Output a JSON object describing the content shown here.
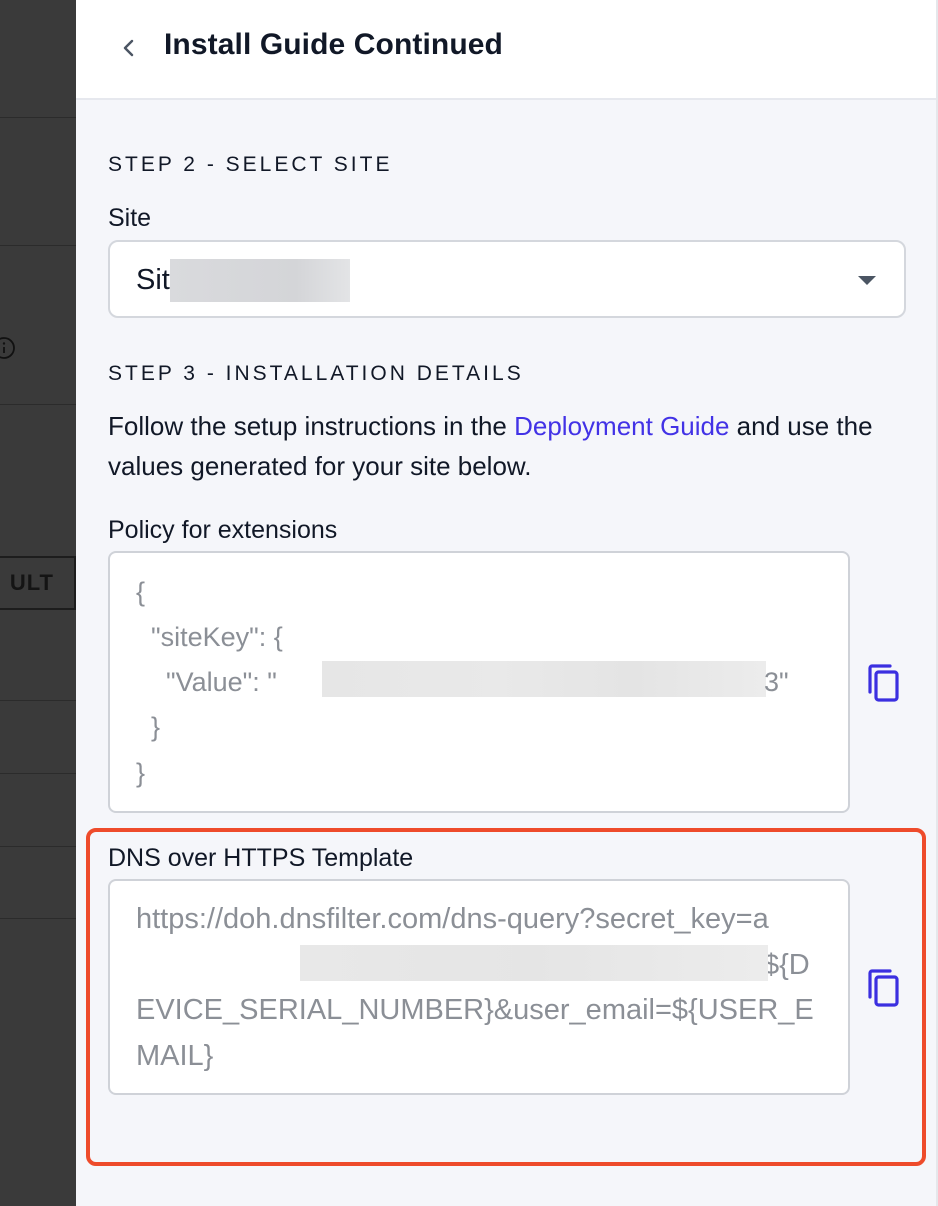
{
  "panel": {
    "title": "Install Guide Continued"
  },
  "background": {
    "chip_label": "ULT"
  },
  "step2": {
    "heading": "STEP 2 - SELECT SITE",
    "site_label": "Site",
    "site_value_visible": "Sit"
  },
  "step3": {
    "heading": "STEP 3 - INSTALLATION DETAILS",
    "instructions_before": "Follow the setup instructions in the ",
    "instructions_link": "Deployment Guide",
    "instructions_after": " and use the values generated for your site below.",
    "policy_label": "Policy for extensions",
    "policy_lines": [
      "{",
      "  \"siteKey\": {",
      "    \"Value\": \"",
      "3\"",
      "  }",
      "}"
    ],
    "doh_label": "DNS over HTTPS Template",
    "doh_part1": "https://doh.dnsfilter.com/dns-query?secret_key=a",
    "doh_part2": "3&device_sn=${DEVICE_SERIAL_NUMBER}&user_email=${USER_EMAIL}"
  },
  "icons": {
    "back": "chevron-left-icon",
    "dropdown": "caret-down-icon",
    "copy": "copy-icon",
    "info": "info-icon"
  },
  "colors": {
    "link": "#4232e6",
    "copy_icon": "#3b2fe0",
    "highlight": "#ee4b2b",
    "panel_bg": "#f5f6fa"
  }
}
